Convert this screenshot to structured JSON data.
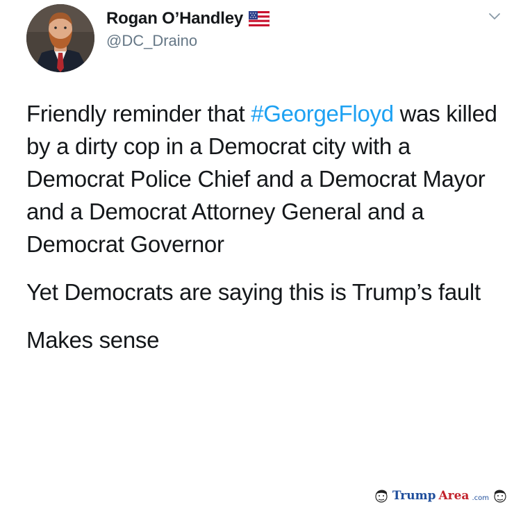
{
  "author": {
    "display_name": "Rogan O’Handley",
    "handle": "@DC_Draino",
    "badge_icon": "us-flag-icon",
    "avatar_icon": "profile-photo"
  },
  "menu": {
    "icon": "chevron-down-icon"
  },
  "tweet": {
    "p1_before": "Friendly reminder that ",
    "hashtag": "#GeorgeFloyd",
    "p1_after": " was killed by a dirty cop in a Democrat city with a Democrat Police Chief and a Democrat Mayor and a Democrat Attorney General and a Democrat Governor",
    "p2": "Yet Democrats are saying this is Trump’s fault",
    "p3": "Makes sense"
  },
  "watermark": {
    "part1": "Trump",
    "part2": "Area",
    "part3": ".com"
  },
  "colors": {
    "hashtag": "#1da1f2",
    "text": "#14171a",
    "handle": "#657786",
    "watermark_blue": "#1f4e9c",
    "watermark_red": "#c2212b"
  }
}
